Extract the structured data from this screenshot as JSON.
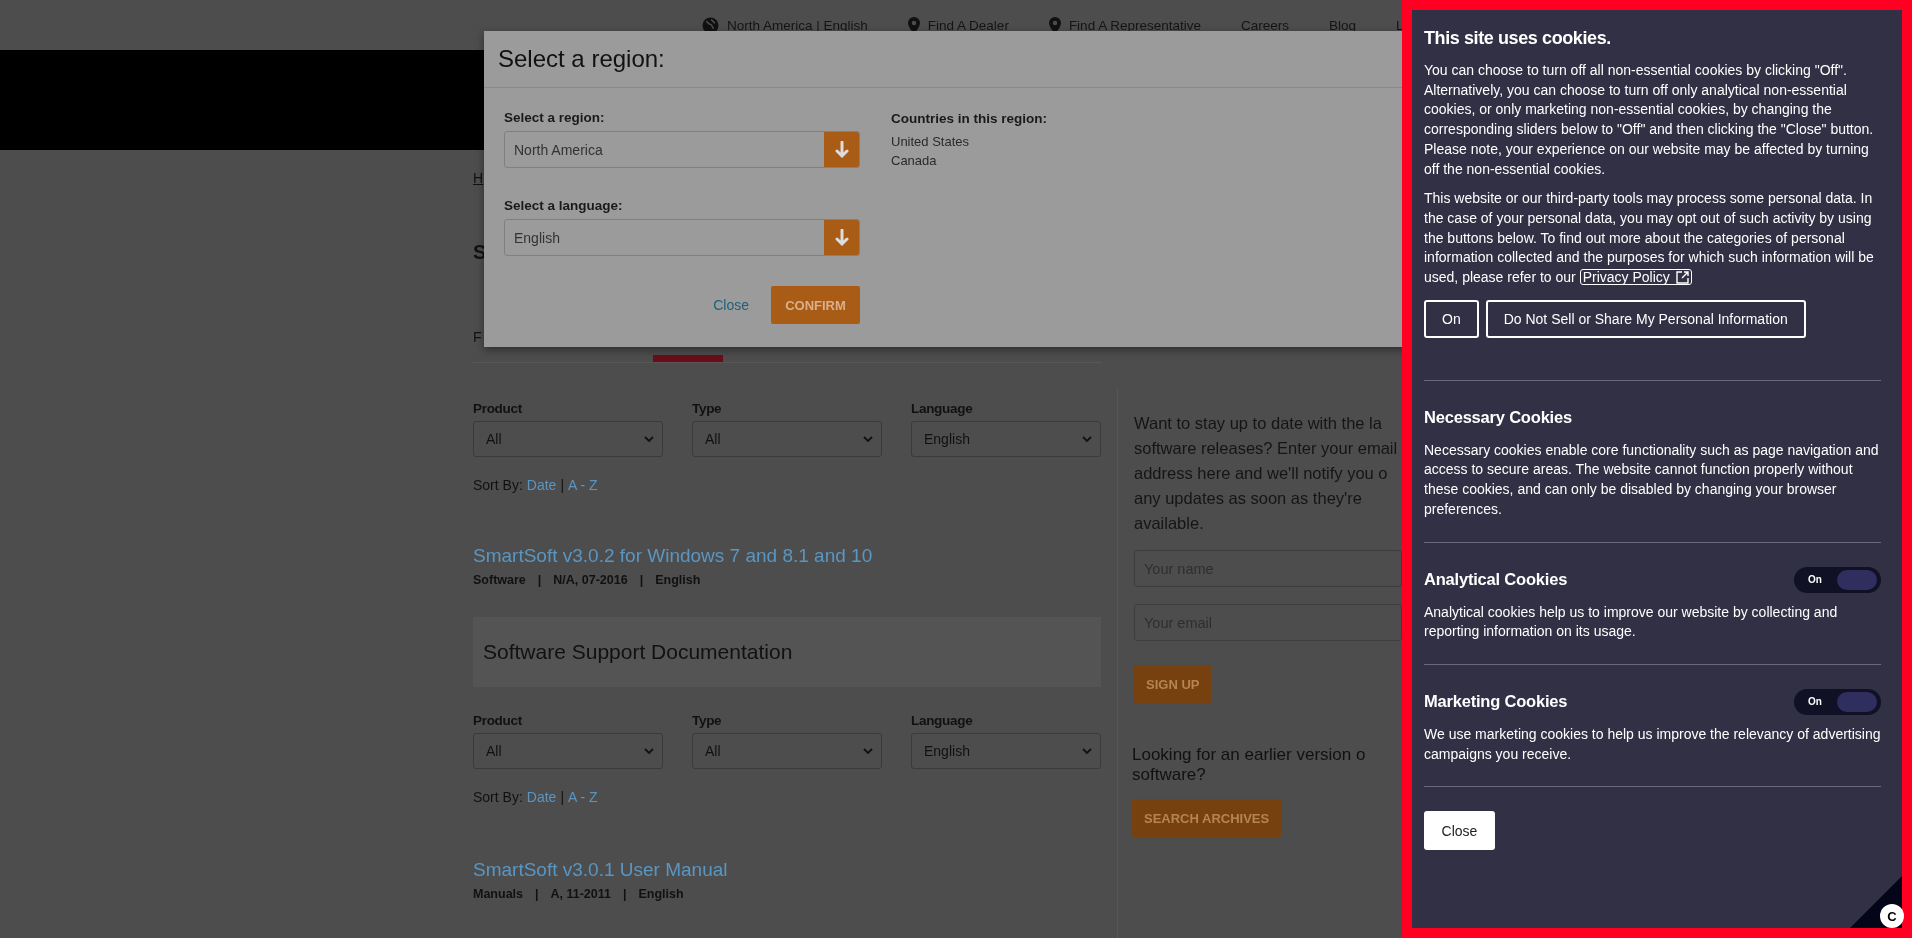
{
  "top_nav": [
    {
      "kind": "globe",
      "label": "North America  |  English"
    },
    {
      "kind": "pin",
      "label": "Find A Dealer"
    },
    {
      "kind": "pin",
      "label": "Find A Representative"
    },
    {
      "kind": "plain",
      "label": "Careers"
    },
    {
      "kind": "plain",
      "label": "Blog"
    },
    {
      "kind": "plain",
      "label": "L"
    }
  ],
  "breadcrumb": "H",
  "page_heading": "S",
  "tabs": [
    {
      "label": "F",
      "selected": false
    },
    {
      "selected": true
    }
  ],
  "blocks": [
    {
      "filters": [
        {
          "label": "Product",
          "value": "All"
        },
        {
          "label": "Type",
          "value": "All"
        },
        {
          "label": "Language",
          "value": "English"
        }
      ],
      "sort": {
        "label": "Sort By:",
        "parts": [
          {
            "kind": "link",
            "text": "Date"
          },
          {
            "kind": "sep",
            "text": "|"
          },
          {
            "kind": "link",
            "text": "A - Z"
          }
        ]
      },
      "items": [
        {
          "title": "SmartSoft v3.0.2 for Windows 7 and 8.1 and 10",
          "meta": [
            "Software",
            "|",
            "N/A, 07-2016",
            "|",
            "English"
          ]
        }
      ]
    },
    {
      "heading": "Software Support Documentation",
      "filters": [
        {
          "label": "Product",
          "value": "All"
        },
        {
          "label": "Type",
          "value": "All"
        },
        {
          "label": "Language",
          "value": "English"
        }
      ],
      "sort": {
        "label": "Sort By:",
        "parts": [
          {
            "kind": "link",
            "text": "Date"
          },
          {
            "kind": "sep",
            "text": "|"
          },
          {
            "kind": "link",
            "text": "A - Z"
          }
        ]
      },
      "items": [
        {
          "title": "SmartSoft v3.0.1 User Manual",
          "meta": [
            "Manuals",
            "|",
            "A, 11-2011",
            "|",
            "English"
          ]
        }
      ]
    }
  ],
  "newsletter": {
    "lines": [
      "Want to stay up to date with the la",
      "software releases? Enter your email",
      "address here and we'll notify you o",
      "any updates as soon as they're",
      "available."
    ],
    "fields": [
      {
        "placeholder": "Your name"
      },
      {
        "placeholder": "Your email"
      }
    ],
    "button": "SIGN UP"
  },
  "archives": {
    "heading_lines": [
      "Looking for an earlier version o",
      "software?"
    ],
    "button": "SEARCH ARCHIVES"
  },
  "modal": {
    "title": "Select a region:",
    "selects": [
      {
        "label": "Select a region:",
        "value": "North America"
      },
      {
        "label": "Select a language:",
        "value": "English"
      }
    ],
    "countries": {
      "heading": "Countries in this region:",
      "items": [
        "United States",
        "Canada"
      ]
    },
    "close": "Close",
    "confirm": "CONFIRM"
  },
  "cookie": {
    "title": "This site uses cookies.",
    "paragraph_1": "You can choose to turn off all non-essential cookies by clicking \"Off\". Alternatively, you can choose to turn off only analytical non-essential cookies, or only marketing non-essential cookies, by changing the corresponding sliders below to \"Off\" and then clicking the \"Close\" button. Please note, your experience on our website may be affected by turning off the non-essential cookies.",
    "paragraph_2": "This website or our third-party tools may process some personal data. In the case of your personal data, you may opt out of such activity by using the buttons below. To find out more about the categories of personal information collected and the purposes for which such information will be used, please refer to our",
    "policy_link": "Privacy Policy",
    "buttons": [
      "On",
      "Do Not Sell or Share My Personal Information"
    ],
    "categories": [
      {
        "name": "Necessary Cookies",
        "text": "Necessary cookies enable core functionality such as page navigation and access to secure areas. The website cannot function properly without these cookies, and can only be disabled by changing your browser preferences."
      },
      {
        "name": "Analytical Cookies",
        "text": "Analytical cookies help us to improve our website by collecting and reporting information on its usage.",
        "toggle": {
          "on": true,
          "label": "On"
        }
      },
      {
        "name": "Marketing Cookies",
        "text": "We use marketing cookies to help us improve the relevancy of advertising campaigns you receive.",
        "toggle": {
          "on": true,
          "label": "On"
        }
      }
    ],
    "close": "Close",
    "badge": "C"
  }
}
